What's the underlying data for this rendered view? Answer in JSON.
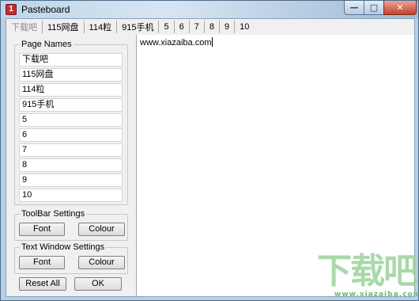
{
  "window": {
    "title": "Pasteboard",
    "app_icon_glyph": "1",
    "min_glyph": "—",
    "max_glyph": "□",
    "close_glyph": "✕"
  },
  "tabs": [
    {
      "label": "下载吧",
      "active": true
    },
    {
      "label": "115网盘",
      "active": false
    },
    {
      "label": "114粒",
      "active": false
    },
    {
      "label": "915手机",
      "active": false
    },
    {
      "label": "5",
      "active": false
    },
    {
      "label": "6",
      "active": false
    },
    {
      "label": "7",
      "active": false
    },
    {
      "label": "8",
      "active": false
    },
    {
      "label": "9",
      "active": false
    },
    {
      "label": "10",
      "active": false
    }
  ],
  "page_names": {
    "title": "Page Names",
    "fields": [
      "下载吧",
      "115网盘",
      "114粒",
      "915手机",
      "5",
      "6",
      "7",
      "8",
      "9",
      "10"
    ]
  },
  "toolbar_settings": {
    "title": "ToolBar Settings",
    "font_label": "Font",
    "colour_label": "Colour"
  },
  "text_window_settings": {
    "title": "Text Window Settings",
    "font_label": "Font",
    "colour_label": "Colour"
  },
  "buttons": {
    "reset_all": "Reset All",
    "ok": "OK"
  },
  "text_window": {
    "content": "www.xiazaiba.com"
  },
  "watermark": {
    "big": "下载吧",
    "small": "www.xiazaiba.com"
  },
  "colors": {
    "titlebar": "#bfd5ea",
    "close_button": "#c5422a",
    "watermark": "#9bd39c"
  }
}
